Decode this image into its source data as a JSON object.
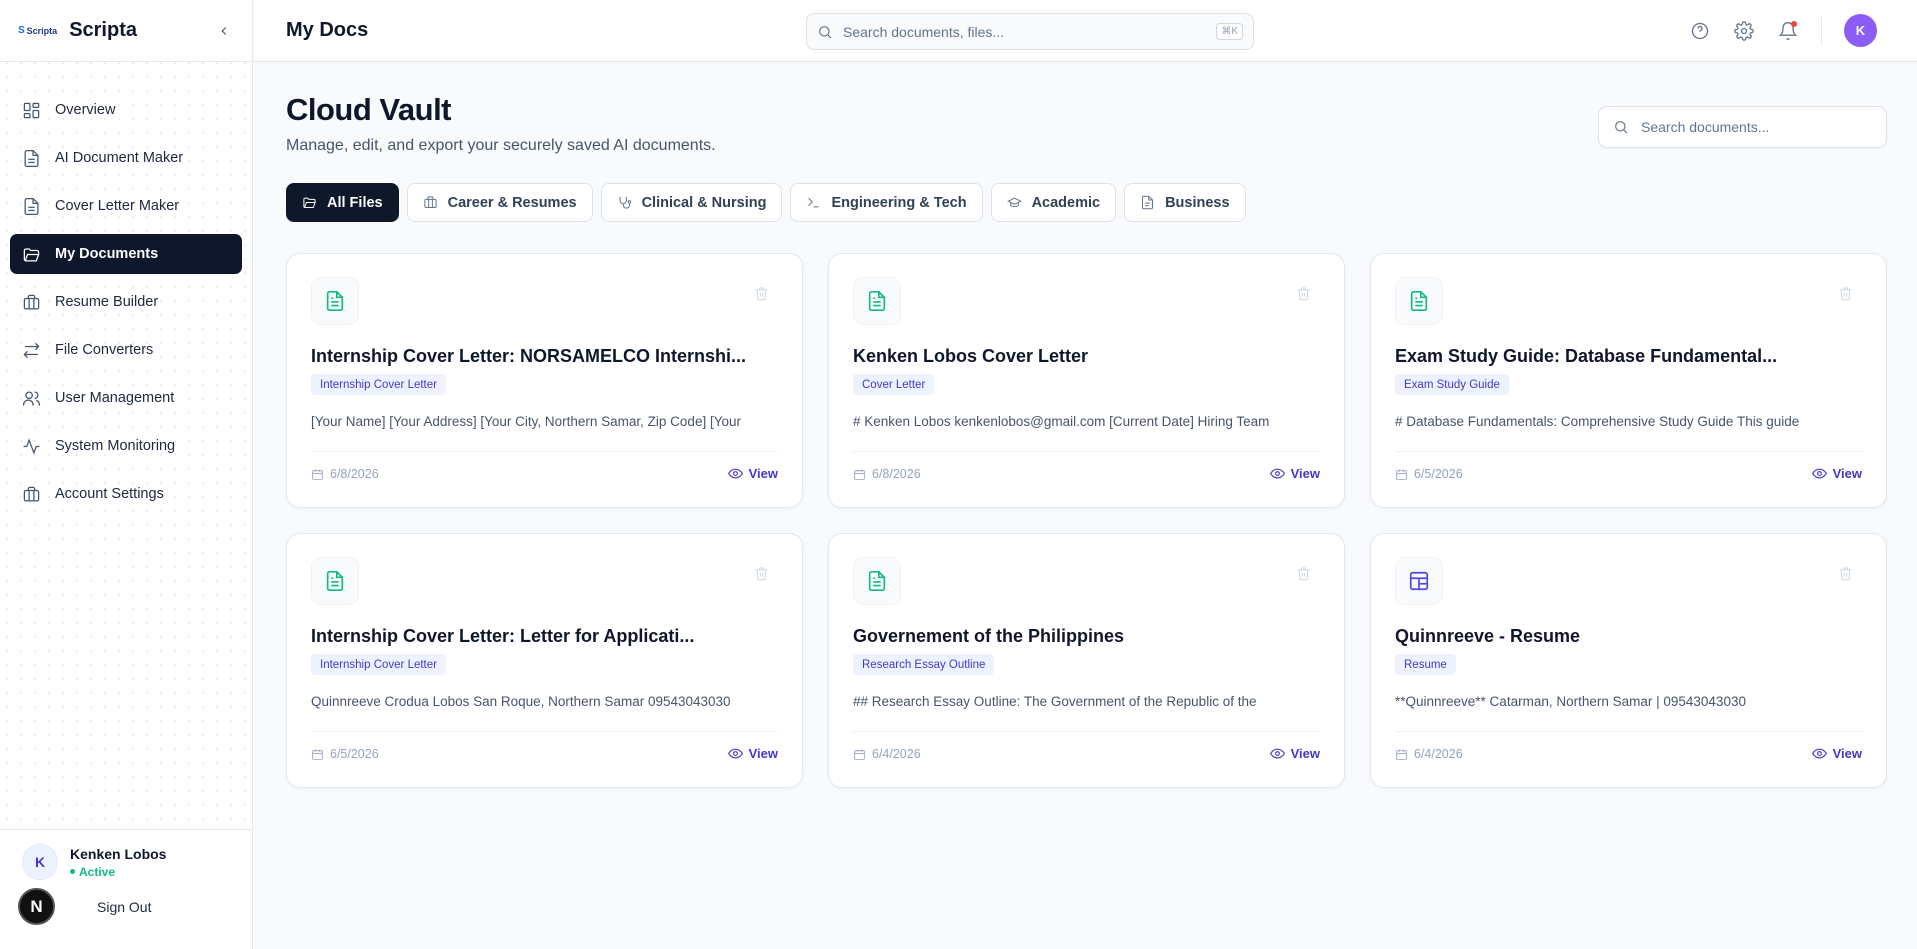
{
  "app": {
    "brand": "Scripta",
    "logo_text": "Scripta",
    "logo_letter": "S"
  },
  "sidebar": {
    "items": [
      {
        "label": "Overview",
        "icon": "dashboard-icon",
        "active": false
      },
      {
        "label": "AI Document Maker",
        "icon": "document-icon",
        "active": false
      },
      {
        "label": "Cover Letter Maker",
        "icon": "document-icon",
        "active": false
      },
      {
        "label": "My Documents",
        "icon": "folder-icon",
        "active": true
      },
      {
        "label": "Resume Builder",
        "icon": "briefcase-icon",
        "active": false
      },
      {
        "label": "File Converters",
        "icon": "swap-icon",
        "active": false
      },
      {
        "label": "User Management",
        "icon": "users-icon",
        "active": false
      },
      {
        "label": "System Monitoring",
        "icon": "activity-icon",
        "active": false
      },
      {
        "label": "Account Settings",
        "icon": "briefcase-icon",
        "active": false
      }
    ],
    "user": {
      "initial": "K",
      "name": "Kenken Lobos",
      "status": "Active"
    },
    "next_badge": "N",
    "sign_out": "Sign Out"
  },
  "topbar": {
    "title": "My Docs",
    "search_placeholder": "Search documents, files...",
    "shortcut": "⌘K",
    "avatar_initial": "K"
  },
  "main": {
    "title": "Cloud Vault",
    "subtitle": "Manage, edit, and export your securely saved AI documents.",
    "search_placeholder": "Search documents...",
    "tabs": [
      {
        "label": "All Files",
        "icon": "folder-open-icon",
        "active": true
      },
      {
        "label": "Career & Resumes",
        "icon": "briefcase-icon",
        "active": false
      },
      {
        "label": "Clinical & Nursing",
        "icon": "stethoscope-icon",
        "active": false
      },
      {
        "label": "Engineering & Tech",
        "icon": "terminal-icon",
        "active": false
      },
      {
        "label": "Academic",
        "icon": "graduation-cap-icon",
        "active": false
      },
      {
        "label": "Business",
        "icon": "file-icon",
        "active": false
      }
    ],
    "cards": [
      {
        "title": "Internship Cover Letter: NORSAMELCO Internshi...",
        "tag": "Internship Cover Letter",
        "snippet": "[Your Name] [Your Address] [Your City, Northern Samar, Zip Code] [Your",
        "date": "6/8/2026",
        "view": "View",
        "icon": "document-icon"
      },
      {
        "title": "Kenken Lobos Cover Letter",
        "tag": "Cover Letter",
        "snippet": "# Kenken Lobos kenkenlobos@gmail.com [Current Date] Hiring Team",
        "date": "6/8/2026",
        "view": "View",
        "icon": "document-icon"
      },
      {
        "title": "Exam Study Guide: Database Fundamental...",
        "tag": "Exam Study Guide",
        "snippet": "# Database Fundamentals: Comprehensive Study Guide This guide",
        "date": "6/5/2026",
        "view": "View",
        "icon": "document-icon"
      },
      {
        "title": "Internship Cover Letter: Letter for Applicati...",
        "tag": "Internship Cover Letter",
        "snippet": "Quinnreeve Crodua Lobos San Roque, Northern Samar 09543043030",
        "date": "6/5/2026",
        "view": "View",
        "icon": "document-icon"
      },
      {
        "title": "Governement of the Philippines",
        "tag": "Research Essay Outline",
        "snippet": "## Research Essay Outline: The Government of the Republic of the",
        "date": "6/4/2026",
        "view": "View",
        "icon": "document-icon"
      },
      {
        "title": "Quinnreeve - Resume",
        "tag": "Resume",
        "snippet": "**Quinnreeve** Catarman, Northern Samar | 09543043030",
        "date": "6/4/2026",
        "view": "View",
        "icon": "layout-icon"
      }
    ]
  }
}
